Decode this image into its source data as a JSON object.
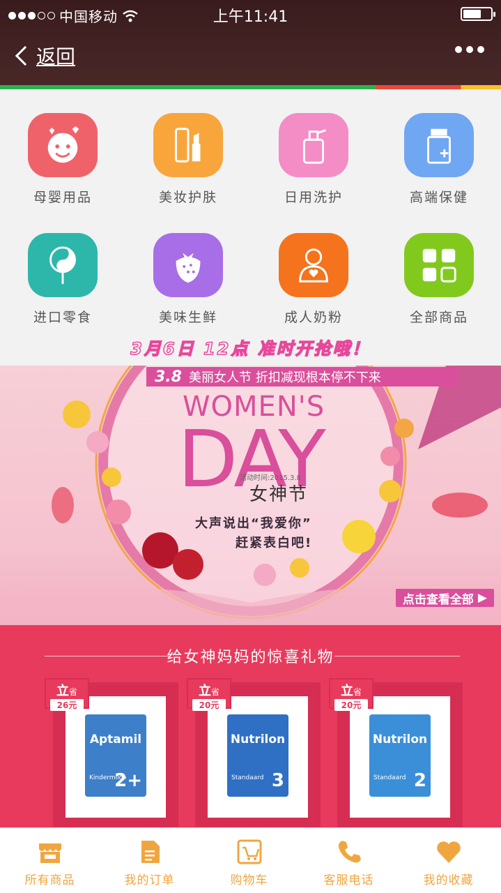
{
  "status": {
    "carrier": "中国移动",
    "time": "上午11:41",
    "battery_level": 0.65
  },
  "nav": {
    "back_label": "返回"
  },
  "categories": [
    {
      "label": "母婴用品",
      "color": "#f0626a",
      "icon": "baby-icon"
    },
    {
      "label": "美妆护肤",
      "color": "#f8a63c",
      "icon": "cosmetics-icon"
    },
    {
      "label": "日用洗护",
      "color": "#f48cc6",
      "icon": "bottle-icon"
    },
    {
      "label": "高端保健",
      "color": "#6fa7f2",
      "icon": "medicine-icon"
    },
    {
      "label": "进口零食",
      "color": "#2db7aa",
      "icon": "lollipop-icon"
    },
    {
      "label": "美味生鲜",
      "color": "#a86ee8",
      "icon": "strawberry-icon"
    },
    {
      "label": "成人奶粉",
      "color": "#f5731c",
      "icon": "adult-icon"
    },
    {
      "label": "全部商品",
      "color": "#82c91e",
      "icon": "grid-icon"
    }
  ],
  "banner": {
    "tagline": "3月6日 12点 准时开抢哦！",
    "ribbon_num": "3.8",
    "ribbon_text": "美丽女人节 折扣减现根本停不下来",
    "womens": "WOMEN'S",
    "day": "DAY",
    "activity_time": "活动时间:2015.3.8",
    "goddess": "女神节",
    "slogan_line1": "大声说出“我爱你”",
    "slogan_line2": "赶紧表白吧!",
    "view_all": "点击查看全部"
  },
  "gift_section": {
    "title": "给女神妈妈的惊喜礼物",
    "products": [
      {
        "badge_top": "立",
        "badge_small": "省",
        "saving": "26元",
        "brand": "Aptamil",
        "sub": "Kindermilch",
        "stage": "2+",
        "color": "#3d7fc8"
      },
      {
        "badge_top": "立",
        "badge_small": "省",
        "saving": "20元",
        "brand": "Nutrilon",
        "sub": "Standaard",
        "stage": "3",
        "color": "#2f6fc4"
      },
      {
        "badge_top": "立",
        "badge_small": "省",
        "saving": "20元",
        "brand": "Nutrilon",
        "sub": "Standaard",
        "stage": "2",
        "color": "#3b8fd8"
      }
    ]
  },
  "tabbar": {
    "items": [
      {
        "label": "所有商品",
        "icon": "store-icon"
      },
      {
        "label": "我的订单",
        "icon": "order-icon"
      },
      {
        "label": "购物车",
        "icon": "cart-icon"
      },
      {
        "label": "客服电话",
        "icon": "phone-icon"
      },
      {
        "label": "我的收藏",
        "icon": "heart-icon"
      }
    ],
    "color": "#f0a640"
  }
}
